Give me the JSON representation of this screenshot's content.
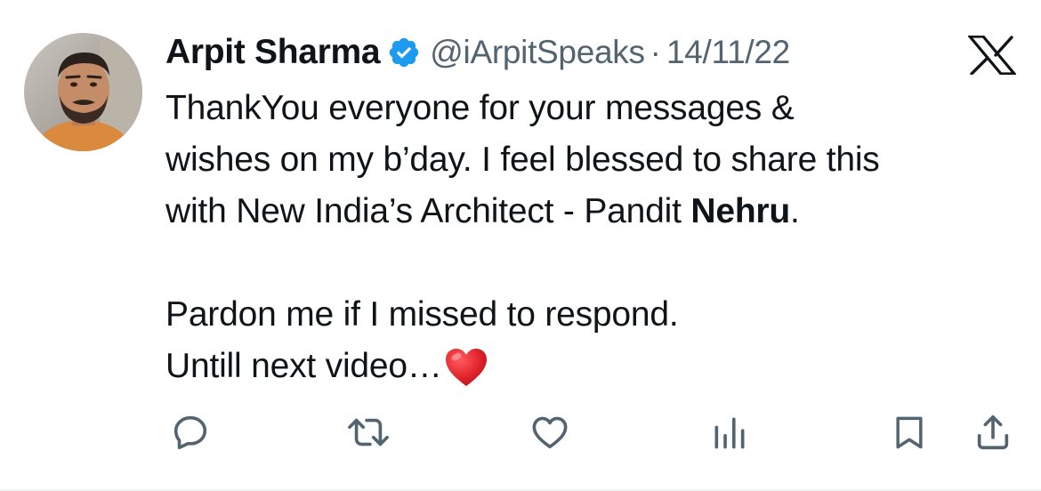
{
  "tweet": {
    "author": {
      "name": "Arpit Sharma",
      "handle": "@iArpitSpeaks",
      "verified": true,
      "avatar": "profile-photo"
    },
    "separator": "·",
    "date": "14/11/22",
    "platform_icon": "x-logo-icon",
    "text": {
      "line1": "ThankYou everyone for your messages &",
      "line2": "wishes on my b’day. I feel blessed to share this",
      "line3_prefix": "with New India’s Architect - Pandit ",
      "line3_bold": "Nehru",
      "line3_suffix": ".",
      "line4": "Pardon me if I missed to respond.",
      "line5": "Untill next video…",
      "emoji": "red-heart"
    },
    "actions": [
      {
        "name": "reply",
        "icon": "reply-icon"
      },
      {
        "name": "retweet",
        "icon": "retweet-icon"
      },
      {
        "name": "like",
        "icon": "heart-icon"
      },
      {
        "name": "views",
        "icon": "views-icon"
      },
      {
        "name": "bookmark",
        "icon": "bookmark-icon"
      },
      {
        "name": "share",
        "icon": "share-icon"
      }
    ]
  },
  "colors": {
    "text_primary": "#0f1419",
    "text_secondary": "#536471",
    "verified_blue": "#1d9bf0",
    "heart_red": "#e0242b"
  }
}
